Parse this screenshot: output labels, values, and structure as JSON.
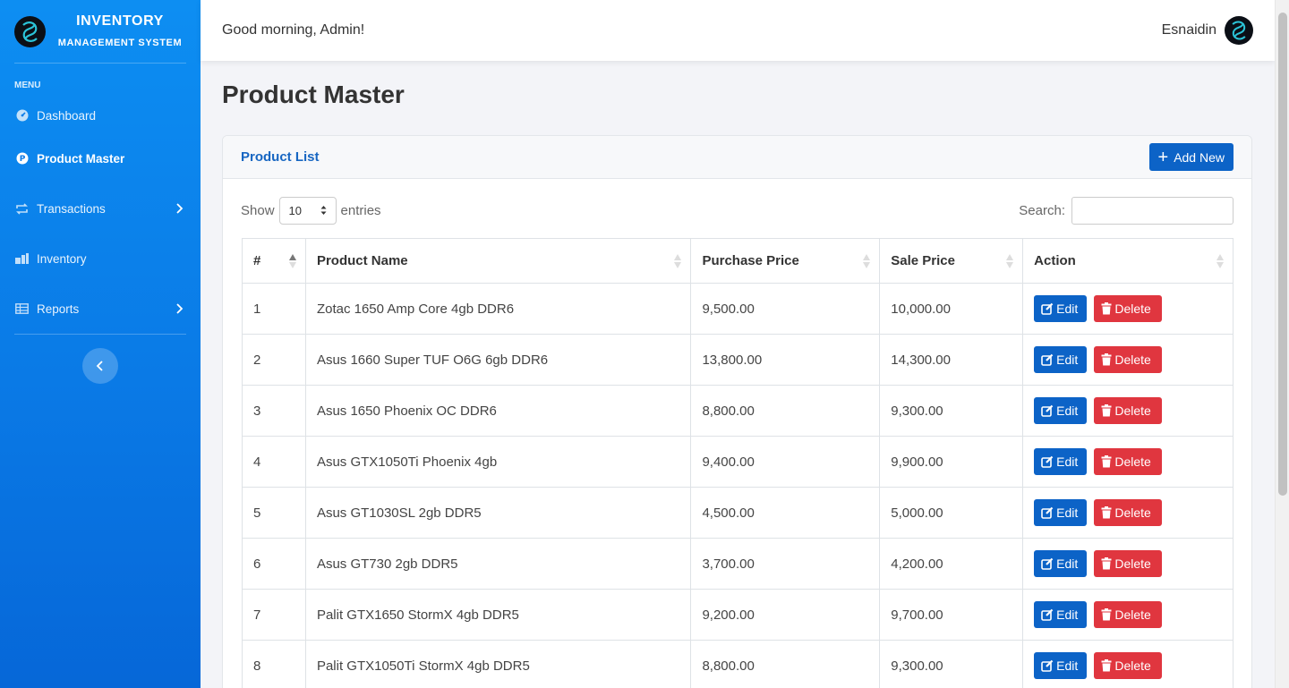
{
  "sidebar": {
    "brand_title": "INVENTORY",
    "brand_subtitle": "MANAGEMENT SYSTEM",
    "menu_heading": "MENU",
    "items": [
      {
        "label": "Dashboard",
        "icon": "gauge-icon",
        "active": false
      },
      {
        "label": "Product Master",
        "icon": "p-circle-icon",
        "active": true
      },
      {
        "label": "Transactions",
        "icon": "repeat-icon",
        "active": false,
        "has_submenu": true
      },
      {
        "label": "Inventory",
        "icon": "boxes-icon",
        "active": false
      },
      {
        "label": "Reports",
        "icon": "table-icon",
        "active": false,
        "has_submenu": true
      }
    ]
  },
  "header": {
    "greeting": "Good morning, Admin!",
    "username": "Esnaidin"
  },
  "page": {
    "title": "Product Master"
  },
  "card": {
    "title": "Product List",
    "add_button_label": "Add New",
    "show_label": "Show",
    "entries_value": "10",
    "entries_label": "entries",
    "search_label": "Search:",
    "search_value": ""
  },
  "table": {
    "columns": [
      "#",
      "Product Name",
      "Purchase Price",
      "Sale Price",
      "Action"
    ],
    "edit_label": "Edit",
    "delete_label": "Delete",
    "rows": [
      {
        "num": "1",
        "name": "Zotac 1650 Amp Core 4gb DDR6",
        "purchase": "9,500.00",
        "sale": "10,000.00"
      },
      {
        "num": "2",
        "name": "Asus 1660 Super TUF O6G 6gb DDR6",
        "purchase": "13,800.00",
        "sale": "14,300.00"
      },
      {
        "num": "3",
        "name": "Asus 1650 Phoenix OC DDR6",
        "purchase": "8,800.00",
        "sale": "9,300.00"
      },
      {
        "num": "4",
        "name": "Asus GTX1050Ti Phoenix 4gb",
        "purchase": "9,400.00",
        "sale": "9,900.00"
      },
      {
        "num": "5",
        "name": "Asus GT1030SL 2gb DDR5",
        "purchase": "4,500.00",
        "sale": "5,000.00"
      },
      {
        "num": "6",
        "name": "Asus GT730 2gb DDR5",
        "purchase": "3,700.00",
        "sale": "4,200.00"
      },
      {
        "num": "7",
        "name": "Palit GTX1650 StormX 4gb DDR5",
        "purchase": "9,200.00",
        "sale": "9,700.00"
      },
      {
        "num": "8",
        "name": "Palit GTX1050Ti StormX 4gb DDR5",
        "purchase": "8,800.00",
        "sale": "9,300.00"
      }
    ]
  },
  "colors": {
    "sidebar": "#0a7ae6",
    "primary": "#0c63c7",
    "danger": "#e0363f",
    "card_title": "#1766c2"
  }
}
